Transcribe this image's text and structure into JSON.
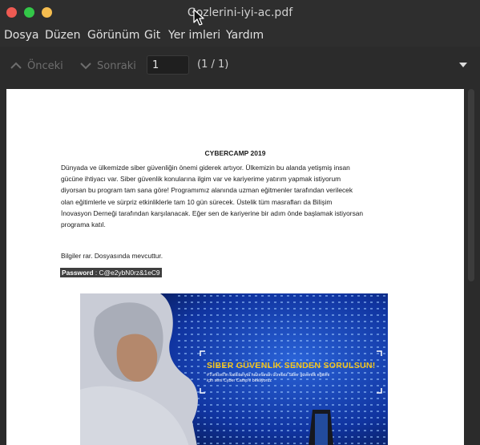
{
  "window": {
    "title": "Gozlerini-iyi-ac.pdf",
    "colors": {
      "close": "#ee5a52",
      "minimize": "#33c748",
      "maximize": "#f5bd4f"
    }
  },
  "menubar": {
    "items": [
      {
        "id": "dosya",
        "label": "Dosya"
      },
      {
        "id": "duzen",
        "label": "Düzen"
      },
      {
        "id": "gorunum",
        "label": "Görünüm"
      },
      {
        "id": "git",
        "label": "Git"
      },
      {
        "id": "yer-imleri",
        "label": "Yer imleri"
      },
      {
        "id": "yardim",
        "label": "Yardım"
      }
    ]
  },
  "toolbar": {
    "prev_label": "Önceki",
    "next_label": "Sonraki",
    "page_value": "1",
    "page_count": "(1 / 1)"
  },
  "document": {
    "title": "CYBERCAMP 2019",
    "lines": [
      "Dünyada ve ülkemizde siber güvenliğin önemi giderek artıyor. Ülkemizin bu alanda yetişmiş insan",
      "gücüne ihtiyacı var. Siber güvenlik konularına ilgim var ve kariyerime yatırım yapmak istiyorum",
      "diyorsan bu program tam sana göre! Programımız alanında uzman eğitmenler tarafından verilecek",
      "olan eğitimlerle ve sürpriz etkinliklerle tam 10 gün sürecek. Üstelik tüm masrafları da Bilişim",
      "İnovasyon Derneği tarafından karşılanacak. Eğer sen de kariyerine bir adım önde başlamak istiyorsan",
      "programa katıl."
    ],
    "info": "Bilgiler rar. Dosyasında mevcuttur.",
    "password_label": "Password",
    "password_value": ": C@e2ybN0rz&1eC9"
  },
  "banner": {
    "title": "SİBER GÜVENLİK SENDEN SORULSUN!",
    "subtitle_1": "#Turkcell'in katkılarıyla hazırlanan ücretsiz Siber güvenlik eğitimi",
    "subtitle_2": "için seni Cyber Camp'e bekliyoruz"
  },
  "icons": {
    "cursor": "mouse-pointer-icon",
    "prev": "chevron-up-icon",
    "next": "chevron-down-icon",
    "menu": "dropdown-arrow-icon"
  }
}
